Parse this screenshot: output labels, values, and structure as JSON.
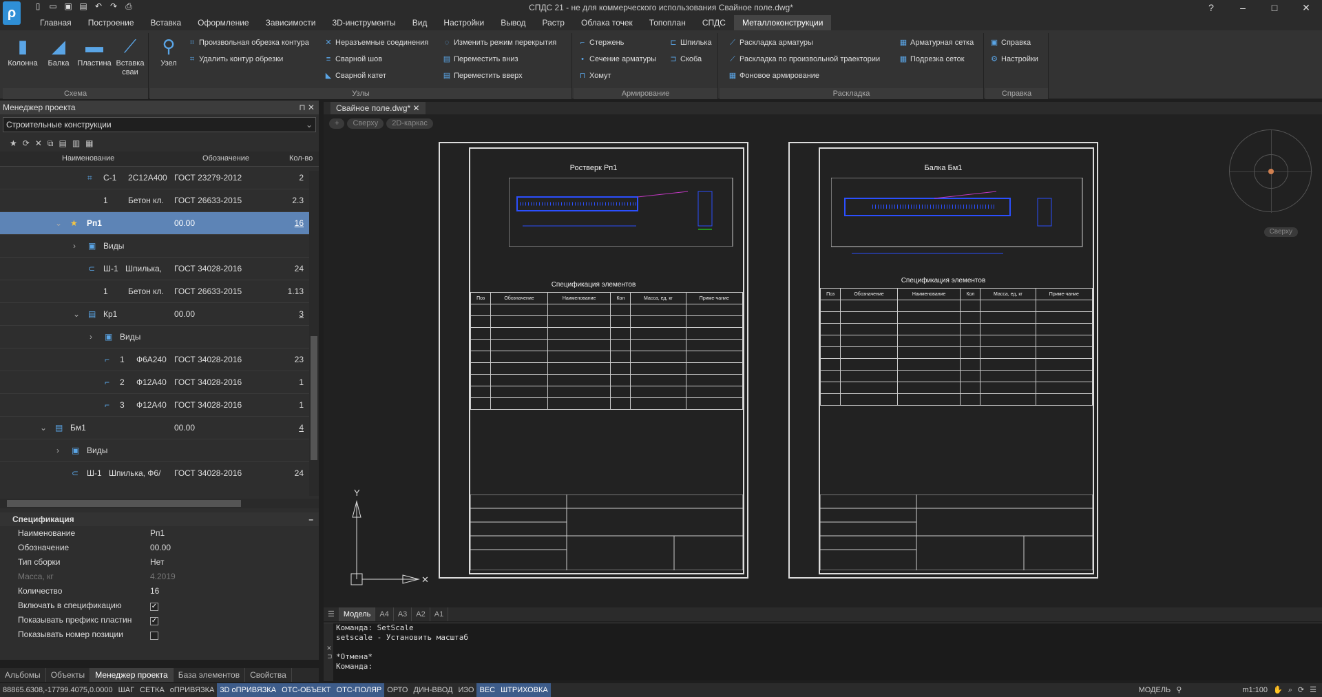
{
  "window": {
    "title": "СПДС 21 - не для коммерческого использования Свайное поле.dwg*"
  },
  "menu_tabs": [
    "Главная",
    "Построение",
    "Вставка",
    "Оформление",
    "Зависимости",
    "3D-инструменты",
    "Вид",
    "Настройки",
    "Вывод",
    "Растр",
    "Облака точек",
    "Топоплан",
    "СПДС",
    "Металлоконструкции"
  ],
  "active_tab": "Металлоконструкции",
  "ribbon": {
    "schema": {
      "title": "Схема",
      "buttons": [
        "Колонна",
        "Балка",
        "Пластина",
        "Вставка сваи"
      ]
    },
    "nodes": {
      "title": "Узлы",
      "big": "Узел",
      "items": [
        "Произвольная обрезка контура",
        "Удалить контур обрезки",
        "Неразъемные соединения",
        "Сварной шов",
        "Сварной катет",
        "Изменить режим перекрытия",
        "Переместить вниз",
        "Переместить вверх"
      ]
    },
    "reinforcement": {
      "title": "Армирование",
      "items": [
        "Стержень",
        "Сечение арматуры",
        "Хомут",
        "Шпилька",
        "Скоба"
      ]
    },
    "layout": {
      "title": "Раскладка",
      "items": [
        "Раскладка арматуры",
        "Раскладка по произвольной траектории",
        "Фоновое армирование",
        "Арматурная сетка",
        "Подрезка сеток"
      ]
    },
    "help": {
      "title": "Справка",
      "items": [
        "Справка",
        "Настройки"
      ]
    }
  },
  "project_manager": {
    "title": "Менеджер проекта",
    "combo": "Строительные конструкции",
    "columns": [
      "Наименование",
      "Обозначение",
      "Кол-во"
    ],
    "rows": [
      {
        "pos": "С-1",
        "name": "2С12А400",
        "code": "ГОСТ 23279-2012",
        "qty": "2"
      },
      {
        "pos": "1",
        "name": "Бетон кл.",
        "code": "ГОСТ 26633-2015",
        "qty": "2.3"
      },
      {
        "pos": "",
        "name": "Рп1",
        "code": "00.00",
        "qty": "16"
      },
      {
        "pos": "",
        "name": "Виды",
        "code": "",
        "qty": ""
      },
      {
        "pos": "Ш-1",
        "name": "Шпилька,",
        "code": "ГОСТ 34028-2016",
        "qty": "24"
      },
      {
        "pos": "1",
        "name": "Бетон кл.",
        "code": "ГОСТ 26633-2015",
        "qty": "1.13"
      },
      {
        "pos": "",
        "name": "Кр1",
        "code": "00.00",
        "qty": "3"
      },
      {
        "pos": "",
        "name": "Виды",
        "code": "",
        "qty": ""
      },
      {
        "pos": "1",
        "name": "Ф6А240",
        "code": "ГОСТ 34028-2016",
        "qty": "23"
      },
      {
        "pos": "2",
        "name": "Ф12А40",
        "code": "ГОСТ 34028-2016",
        "qty": "1"
      },
      {
        "pos": "3",
        "name": "Ф12А40",
        "code": "ГОСТ 34028-2016",
        "qty": "1"
      },
      {
        "pos": "",
        "name": "Бм1",
        "code": "00.00",
        "qty": "4"
      },
      {
        "pos": "",
        "name": "Виды",
        "code": "",
        "qty": ""
      },
      {
        "pos": "Ш-1",
        "name": "Шпилька, Ф6/",
        "code": "ГОСТ 34028-2016",
        "qty": "24"
      }
    ]
  },
  "specification": {
    "title": "Спецификация",
    "props": [
      {
        "k": "Наименование",
        "v": "Рп1"
      },
      {
        "k": "Обозначение",
        "v": "00.00"
      },
      {
        "k": "Тип сборки",
        "v": "Нет"
      },
      {
        "k": "Масса, кг",
        "v": "4.2019"
      },
      {
        "k": "Количество",
        "v": "16"
      },
      {
        "k": "Включать в спецификацию",
        "v": "✓"
      },
      {
        "k": "Показывать префикс пластин",
        "v": "✓"
      },
      {
        "k": "Показывать номер позиции",
        "v": ""
      }
    ]
  },
  "panel_tabs": [
    "Альбомы",
    "Объекты",
    "Менеджер проекта",
    "База элементов",
    "Свойства"
  ],
  "doc_tab": "Свайное поле.dwg*",
  "viewport": {
    "buttons": [
      "+",
      "Сверху",
      "2D-каркас"
    ],
    "compass_label": "Сверху"
  },
  "sheets": [
    {
      "title": "Ростверк Рп1",
      "spec_title": "Спецификация элементов"
    },
    {
      "title": "Балка Бм1",
      "spec_title": "Спецификация элементов"
    }
  ],
  "spec_header": [
    "Поз",
    "Обозначение",
    "Наименование",
    "Кол",
    "Масса, ед, кг",
    "Приме-чание"
  ],
  "layout_tabs": [
    "Модель",
    "А4",
    "А3",
    "А2",
    "А1"
  ],
  "command_lines": [
    "Команда: SetScale",
    "setscale - Установить масштаб",
    "",
    "*Отмена*",
    "Команда:"
  ],
  "status": {
    "coords": "88865.6308,-17799.4075,0.0000",
    "toggles": [
      "ШАГ",
      "СЕТКА",
      "оПРИВЯЗКА",
      "3D оПРИВЯЗКА",
      "ОТС-ОБЪЕКТ",
      "ОТС-ПОЛЯР",
      "ОРТО",
      "ДИН-ВВОД",
      "ИЗО",
      "ВЕС",
      "ШТРИХОВКА"
    ],
    "model": "МОДЕЛЬ",
    "scale": "m1:100"
  }
}
